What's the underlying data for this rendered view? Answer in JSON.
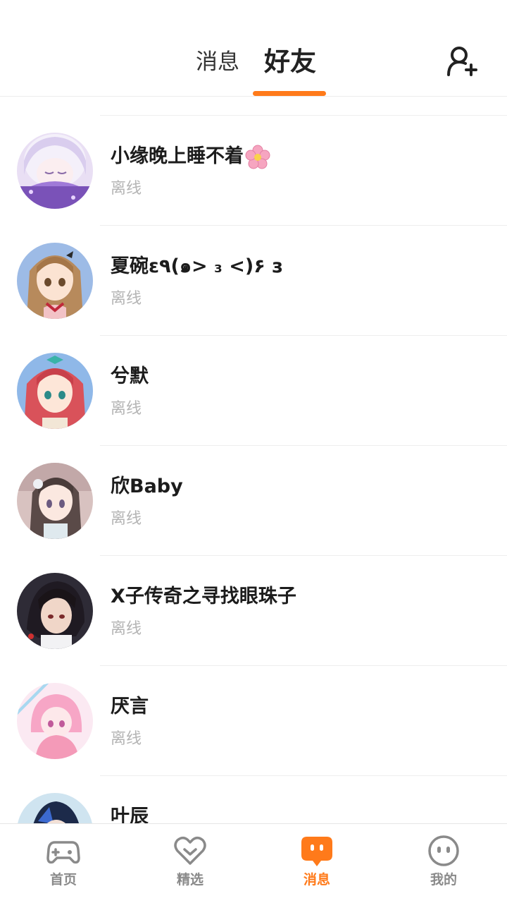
{
  "header": {
    "tabs": [
      {
        "label": "消息",
        "active": false
      },
      {
        "label": "好友",
        "active": true
      }
    ],
    "add_friend_icon": "add-user-icon",
    "accent_color": "#ff7a1a"
  },
  "friends": [
    {
      "name": "小缘晚上睡不着",
      "status": "离线",
      "emoji": "cherry-blossom"
    },
    {
      "name": "夏碗ε٩(๑> ₃ <)۶ з",
      "status": "离线"
    },
    {
      "name": "兮默",
      "status": "离线"
    },
    {
      "name": "欣Baby",
      "status": "离线"
    },
    {
      "name": "X子传奇之寻找眼珠子",
      "status": "离线"
    },
    {
      "name": "厌言",
      "status": "离线"
    },
    {
      "name": "叶辰",
      "status": ""
    }
  ],
  "bottom_nav": [
    {
      "label": "首页",
      "icon": "gamepad-icon",
      "active": false
    },
    {
      "label": "精选",
      "icon": "heart-icon",
      "active": false
    },
    {
      "label": "消息",
      "icon": "chat-bubble-icon",
      "active": true
    },
    {
      "label": "我的",
      "icon": "smiley-face-icon",
      "active": false
    }
  ]
}
